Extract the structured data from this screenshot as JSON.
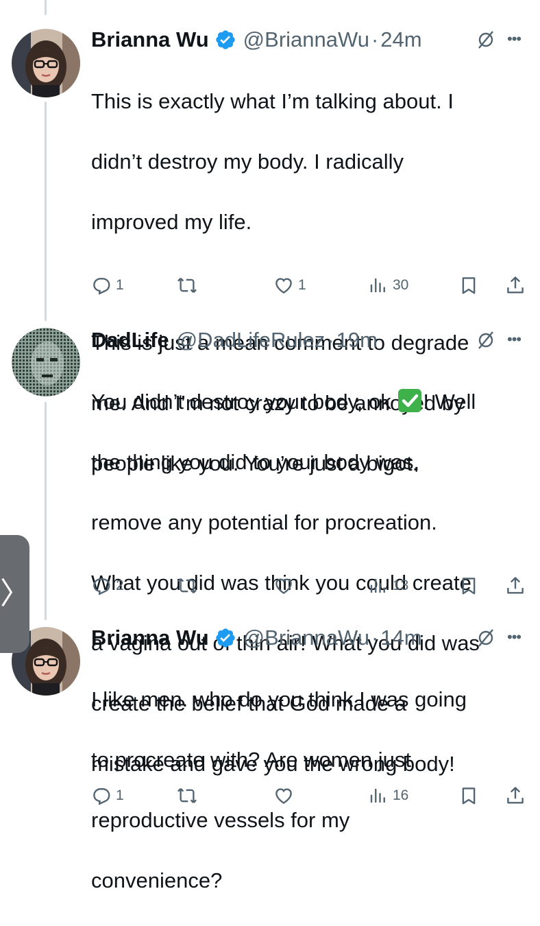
{
  "tweets": [
    {
      "display_name": "Brianna Wu",
      "verified": true,
      "handle": "@BriannaWu",
      "separator": "·",
      "time": "24m",
      "text_lines": [
        "This is exactly what I’m talking about. I",
        "didn’t destroy my body. I radically",
        "improved my life.",
        "",
        "This is just a mean comment to degrade",
        "me. And I’m not crazy to be annoyed by",
        "people like you. You’re just a bigot."
      ],
      "reply_count": "1",
      "retweet_count": "",
      "like_count": "1",
      "view_count": "30"
    },
    {
      "display_name": "DadLife",
      "verified": false,
      "handle": "@DadLifeRulez",
      "separator": "·",
      "time": "19m",
      "text_before_emoji": "You didn’t destroy your body, ok ",
      "emoji": "✅",
      "text_after_emoji": "! Well",
      "text_lines": [
        "the thing you did to your body was,",
        "remove any potential for procreation.",
        "What you did was think you could create",
        "a vagina out of thin air! What you did was",
        "create the belief that God made a",
        "mistake and gave you the wrong body!"
      ],
      "reply_count": "2",
      "retweet_count": "",
      "like_count": "",
      "view_count": "13"
    },
    {
      "display_name": "Brianna Wu",
      "verified": true,
      "handle": "@BriannaWu",
      "separator": "·",
      "time": "14m",
      "text_lines": [
        "I like men. who do you think I was going",
        "to procreate with? Are women just",
        "reproductive vessels for my",
        "convenience?"
      ],
      "reply_count": "1",
      "retweet_count": "",
      "like_count": "",
      "view_count": "16"
    }
  ],
  "side_tab": {
    "glyph": "〉"
  },
  "colors": {
    "text_primary": "#0f1419",
    "text_secondary": "#536471",
    "verified_blue": "#1d9bf0",
    "thread_line": "#cfd9de",
    "side_tab_bg": "#686b6f"
  },
  "icons": [
    "verified-badge-icon",
    "grok-icon",
    "more-icon",
    "reply-icon",
    "retweet-icon",
    "like-icon",
    "views-icon",
    "bookmark-icon",
    "share-icon"
  ]
}
